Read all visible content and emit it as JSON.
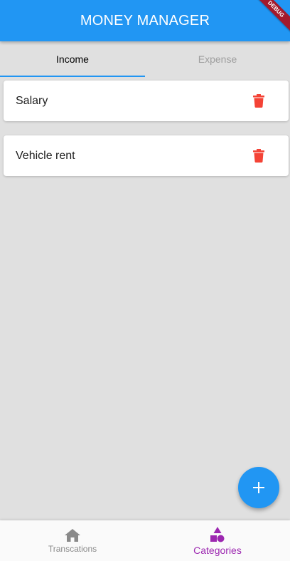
{
  "appbar": {
    "title": "MONEY MANAGER",
    "color": "#2196f3"
  },
  "debug_banner": {
    "label": "DEBUG"
  },
  "tabs": [
    {
      "label": "Income",
      "selected": true
    },
    {
      "label": "Expense",
      "selected": false
    }
  ],
  "categories": [
    {
      "label": "Salary",
      "action_icon": "trash-icon"
    },
    {
      "label": "Vehicle rent",
      "action_icon": "trash-icon"
    }
  ],
  "fab": {
    "icon": "plus-icon"
  },
  "bottom_nav": {
    "items": [
      {
        "label": "Transcations",
        "icon": "home-icon",
        "selected": false
      },
      {
        "label": "Categories",
        "icon": "category-shapes-icon",
        "selected": true
      }
    ]
  },
  "colors": {
    "primary": "#2196f3",
    "delete": "#f44336",
    "nav_active": "#9c27b0",
    "nav_inactive": "#8a8a8a"
  }
}
